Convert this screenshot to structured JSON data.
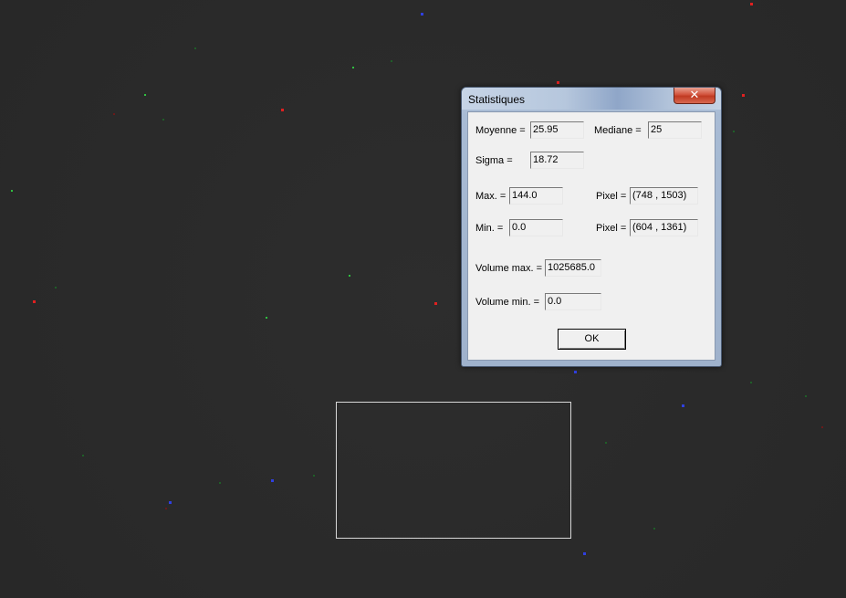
{
  "dialog": {
    "title": "Statistiques",
    "close_glyph": "✕",
    "fields": {
      "moyenne_label": "Moyenne =",
      "moyenne_value": "25.95",
      "mediane_label": "Mediane =",
      "mediane_value": "25",
      "sigma_label": "Sigma =",
      "sigma_value": "18.72",
      "max_label": "Max. =",
      "max_value": "144.0",
      "max_pixel_label": "Pixel =",
      "max_pixel_value": "(748 , 1503)",
      "min_label": "Min. =",
      "min_value": "0.0",
      "min_pixel_label": "Pixel =",
      "min_pixel_value": "(604 , 1361)",
      "volume_max_label": "Volume max. =",
      "volume_max_value": "1025685.0",
      "volume_min_label": "Volume min. =",
      "volume_min_value": "0.0"
    },
    "ok_label": "OK"
  },
  "colors": {
    "background": "#2a2a2a",
    "selection_border": "#d8d8d8",
    "close_button": "#c03a22"
  }
}
